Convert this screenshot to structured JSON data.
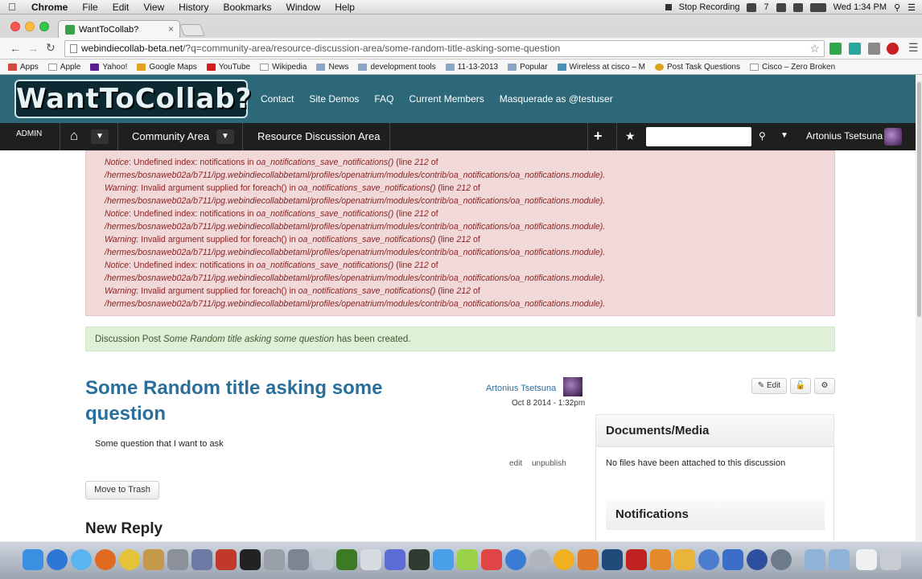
{
  "mac_menu": {
    "app": "Chrome",
    "items": [
      "File",
      "Edit",
      "View",
      "History",
      "Bookmarks",
      "Window",
      "Help"
    ],
    "status_recording": "Stop Recording",
    "badge": "7",
    "clock": "Wed 1:34 PM"
  },
  "browser": {
    "tab_title": "WantToCollab?",
    "url_host": "webindiecollab-beta.net",
    "url_path": "/?q=community-area/resource-discussion-area/some-random-title-asking-some-question",
    "bookmarks": [
      "Apps",
      "Apple",
      "Yahoo!",
      "Google Maps",
      "YouTube",
      "Wikipedia",
      "News",
      "development tools",
      "11-13-2013",
      "Popular",
      "Wireless at cisco – M",
      "Post Task Questions",
      "Cisco – Zero Broken"
    ]
  },
  "site": {
    "logo_text": "WantToCollab?",
    "nav": [
      "Contact",
      "Site Demos",
      "FAQ",
      "Current Members",
      "Masquerade as @testuser"
    ],
    "admin_label": "ADMIN",
    "breadcrumbs": [
      "Community Area",
      "Resource Discussion Area"
    ],
    "user_name": "Artonius Tsetsuna"
  },
  "errors": [
    {
      "kind": "Notice",
      "msg": ": Undefined index: notifications in ",
      "fn": "oa_notifications_save_notifications()",
      "tail": " (line ",
      "line": "212",
      "of": " of"
    },
    {
      "path": "/hermes/bosnaweb02a/b711/ipg.webindiecollabbetaml/profiles/openatrium/modules/contrib/oa_notifications/oa_notifications.module)."
    },
    {
      "kind": "Warning",
      "msg": ": Invalid argument supplied for foreach() in ",
      "fn": "oa_notifications_save_notifications()",
      "tail": " (line ",
      "line": "212",
      "of": " of"
    },
    {
      "path": "/hermes/bosnaweb02a/b711/ipg.webindiecollabbetaml/profiles/openatrium/modules/contrib/oa_notifications/oa_notifications.module)."
    },
    {
      "kind": "Notice",
      "msg": ": Undefined index: notifications in ",
      "fn": "oa_notifications_save_notifications()",
      "tail": " (line ",
      "line": "212",
      "of": " of"
    },
    {
      "path": "/hermes/bosnaweb02a/b711/ipg.webindiecollabbetaml/profiles/openatrium/modules/contrib/oa_notifications/oa_notifications.module)."
    },
    {
      "kind": "Warning",
      "msg": ": Invalid argument supplied for foreach() in ",
      "fn": "oa_notifications_save_notifications()",
      "tail": " (line ",
      "line": "212",
      "of": " of"
    },
    {
      "path": "/hermes/bosnaweb02a/b711/ipg.webindiecollabbetaml/profiles/openatrium/modules/contrib/oa_notifications/oa_notifications.module)."
    },
    {
      "kind": "Notice",
      "msg": ": Undefined index: notifications in ",
      "fn": "oa_notifications_save_notifications()",
      "tail": " (line ",
      "line": "212",
      "of": " of"
    },
    {
      "path": "/hermes/bosnaweb02a/b711/ipg.webindiecollabbetaml/profiles/openatrium/modules/contrib/oa_notifications/oa_notifications.module)."
    },
    {
      "kind": "Warning",
      "msg": ": Invalid argument supplied for foreach() in ",
      "fn": "oa_notifications_save_notifications()",
      "tail": " (line ",
      "line": "212",
      "of": " of"
    },
    {
      "path": "/hermes/bosnaweb02a/b711/ipg.webindiecollabbetaml/profiles/openatrium/modules/contrib/oa_notifications/oa_notifications.module)."
    }
  ],
  "status": {
    "prefix": "Discussion Post ",
    "title": "Some Random title asking some question",
    "suffix": " has been created."
  },
  "post": {
    "title": "Some Random title asking some question",
    "author": "Artonius Tsetsuna",
    "date": "Oct 8 2014 - 1:32pm",
    "body": "Some question that I want to ask",
    "edit_btn": "Edit",
    "edit_link": "edit",
    "unpublish_link": "unpublish",
    "trash_btn": "Move to Trash",
    "new_reply": "New Reply"
  },
  "sidebar": {
    "docs_title": "Documents/Media",
    "docs_body": "No files have been attached to this discussion",
    "notifications_title": "Notifications"
  },
  "colors": {
    "header": "#2d6879",
    "error_bg": "#f2d9d9",
    "success_bg": "#dff0d8",
    "link": "#2a6f9c"
  }
}
